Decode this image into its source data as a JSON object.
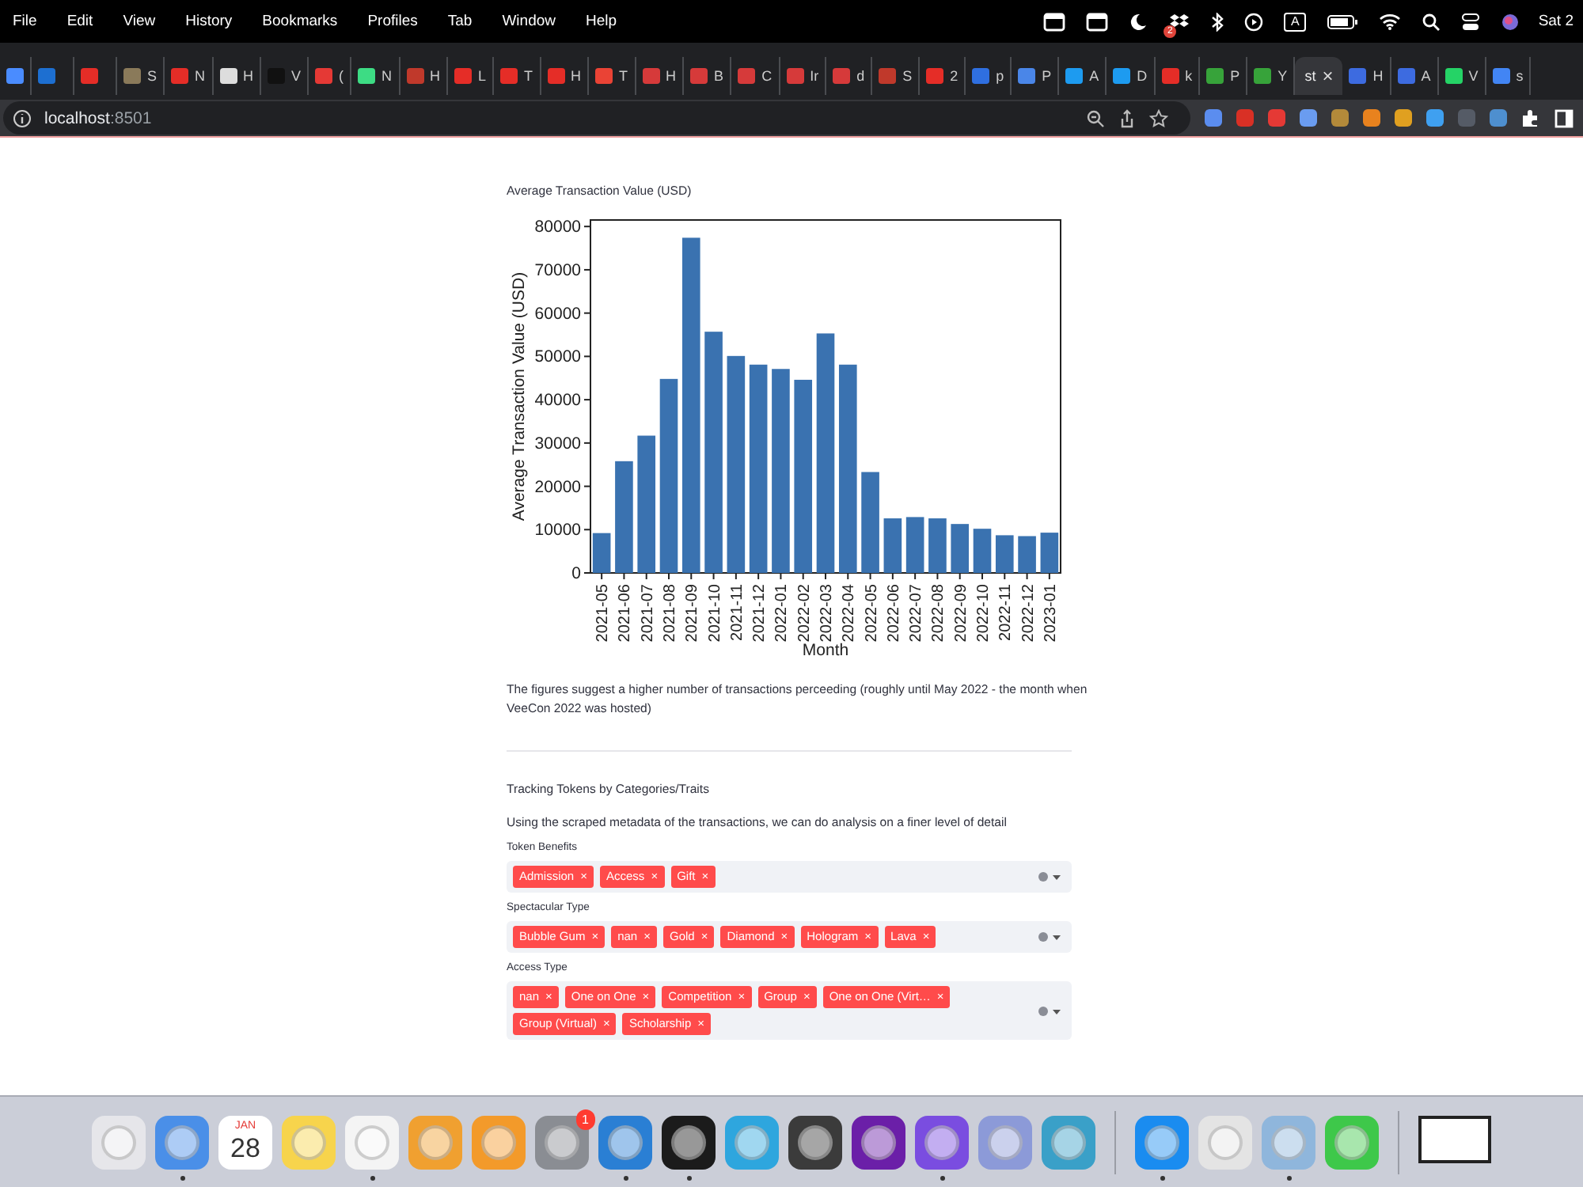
{
  "menu_bar": {
    "items": [
      "File",
      "Edit",
      "View",
      "History",
      "Bookmarks",
      "Profiles",
      "Tab",
      "Window",
      "Help"
    ],
    "status": [
      {
        "kind": "window"
      },
      {
        "kind": "window"
      },
      {
        "kind": "moon"
      },
      {
        "kind": "dropbox",
        "badge": "2"
      },
      {
        "kind": "bluetooth"
      },
      {
        "kind": "play"
      },
      {
        "kind": "input",
        "label": "A"
      },
      {
        "kind": "battery"
      },
      {
        "kind": "wifi"
      },
      {
        "kind": "search"
      },
      {
        "kind": "control"
      },
      {
        "kind": "siri"
      }
    ],
    "clock": "Sat 2"
  },
  "tabs": [
    {
      "color": "#4a8cff",
      "selected": false
    },
    {
      "color": "#1d6fd1",
      "selected": false
    },
    {
      "color": "#e52d27",
      "selected": false
    },
    {
      "title": "S",
      "color": "#8a7a5a",
      "selected": false
    },
    {
      "title": "N",
      "color": "#e52d27",
      "selected": false
    },
    {
      "title": "H",
      "color": "#dddddd",
      "selected": false
    },
    {
      "title": "V",
      "color": "#111111",
      "selected": false
    },
    {
      "title": "(",
      "color": "#e53935",
      "selected": false
    },
    {
      "title": "N",
      "color": "#3ddc84",
      "selected": false
    },
    {
      "title": "H",
      "color": "#c0392b",
      "selected": false
    },
    {
      "title": "L",
      "color": "#e52d27",
      "selected": false
    },
    {
      "title": "T",
      "color": "#e52d27",
      "selected": false
    },
    {
      "title": "H",
      "color": "#e52d27",
      "selected": false
    },
    {
      "title": "T",
      "color": "#ea4335",
      "selected": false
    },
    {
      "title": "H",
      "color": "#d63a3a",
      "selected": false
    },
    {
      "title": "B",
      "color": "#d63a3a",
      "selected": false
    },
    {
      "title": "C",
      "color": "#d63a3a",
      "selected": false
    },
    {
      "title": "Ir",
      "color": "#d63a3a",
      "selected": false
    },
    {
      "title": "d",
      "color": "#d63a3a",
      "selected": false
    },
    {
      "title": "S",
      "color": "#c0392b",
      "selected": false
    },
    {
      "title": "2",
      "color": "#e52d27",
      "selected": false
    },
    {
      "title": "p",
      "color": "#2f6fe0",
      "selected": false
    },
    {
      "title": "P",
      "color": "#4a86e8",
      "selected": false
    },
    {
      "title": "A",
      "color": "#1d9bf0",
      "selected": false
    },
    {
      "title": "D",
      "color": "#1d9bf0",
      "selected": false
    },
    {
      "title": "k",
      "color": "#e52d27",
      "selected": false
    },
    {
      "title": "P",
      "color": "#37a33a",
      "selected": false
    },
    {
      "title": "Y",
      "color": "#37a33a",
      "selected": false
    },
    {
      "title": "st",
      "close": "×",
      "selected": true
    },
    {
      "title": "H",
      "color": "#3d6be0",
      "selected": false
    },
    {
      "title": "A",
      "color": "#3d6be0",
      "selected": false
    },
    {
      "title": "V",
      "color": "#25d366",
      "selected": false
    },
    {
      "title": "s",
      "color": "#4285f4",
      "selected": false
    }
  ],
  "address_bar": {
    "host": "localhost",
    "port": ":8501",
    "extensions": [
      {
        "color": "#5b8def"
      },
      {
        "color": "#d93025"
      },
      {
        "color": "#e53935"
      },
      {
        "color": "#6a9cf0"
      },
      {
        "color": "#b38a3a"
      },
      {
        "color": "#e8821e"
      },
      {
        "color": "#e0a020"
      },
      {
        "color": "#3fa0f0"
      },
      {
        "color": "#555b66"
      },
      {
        "color": "#4e8fcf"
      }
    ]
  },
  "page": {
    "chart_title": "Average Transaction Value (USD)",
    "chart_data": {
      "type": "bar",
      "xlabel": "Month",
      "ylabel": "Average Transaction Value (USD)",
      "categories": [
        "2021-05",
        "2021-06",
        "2021-07",
        "2021-08",
        "2021-09",
        "2021-10",
        "2021-11",
        "2021-12",
        "2022-01",
        "2022-02",
        "2022-03",
        "2022-04",
        "2022-05",
        "2022-06",
        "2022-07",
        "2022-08",
        "2022-09",
        "2022-10",
        "2022-11",
        "2022-12",
        "2023-01"
      ],
      "series": [
        {
          "color": "#3a72b0",
          "values": [
            9200,
            25800,
            31700,
            44800,
            77400,
            55700,
            50100,
            48100,
            47100,
            44600,
            55300,
            48100,
            23300,
            12600,
            12900,
            12600,
            11300,
            10200,
            8700,
            8500,
            9300
          ]
        }
      ],
      "ylim": [
        0,
        81500
      ],
      "yticks": [
        0,
        10000,
        20000,
        30000,
        40000,
        50000,
        60000,
        70000,
        80000
      ]
    },
    "note": "The figures suggest a higher number of transactions perceeding (roughly until May 2022 - the month when VeeCon 2022 was hosted)",
    "section_title": "Tracking Tokens by Categories/Traits",
    "intro": "Using the scraped metadata of the transactions, we can do analysis on a finer level of detail",
    "multiselects": [
      {
        "label": "Token Benefits",
        "tags": [
          "Admission",
          "Access",
          "Gift"
        ]
      },
      {
        "label": "Spectacular Type",
        "tags": [
          "Bubble Gum",
          "nan",
          "Gold",
          "Diamond",
          "Hologram",
          "Lava"
        ]
      },
      {
        "label": "Access Type",
        "tags": [
          "nan",
          "One on One",
          "Competition",
          "Group",
          "One on One (Virt…",
          "Group (Virtual)",
          "Scholarship"
        ]
      }
    ],
    "tag_remove": "×"
  },
  "dock": {
    "groups": [
      [
        {
          "kind": "tile",
          "color": "#e6e6ea",
          "running": false
        },
        {
          "kind": "tile",
          "color": "#4a8fe8",
          "running": true
        },
        {
          "kind": "calendar",
          "month": "JAN",
          "day": "28",
          "running": false
        },
        {
          "kind": "tile",
          "color": "#f7d44c",
          "running": false
        },
        {
          "kind": "tile",
          "color": "#f4f4f4",
          "running": true
        },
        {
          "kind": "tile",
          "color": "#f0a030",
          "running": false
        },
        {
          "kind": "tile",
          "color": "#f39a2a",
          "running": false
        },
        {
          "kind": "tile",
          "color": "#8a8d93",
          "badge": "1",
          "running": false
        },
        {
          "kind": "tile",
          "color": "#2a7fd4",
          "running": true
        },
        {
          "kind": "tile",
          "color": "#1b1b1b",
          "running": true
        },
        {
          "kind": "tile",
          "color": "#2ea6de",
          "running": false
        },
        {
          "kind": "tile",
          "color": "#3b3b3b",
          "running": false
        },
        {
          "kind": "tile",
          "color": "#6b1fa8",
          "running": false
        },
        {
          "kind": "tile",
          "color": "#7a4de0",
          "running": true
        },
        {
          "kind": "tile",
          "color": "#8c9ad8",
          "running": false
        },
        {
          "kind": "tile",
          "color": "#3aa0c8",
          "running": false
        }
      ],
      [
        {
          "kind": "tile",
          "color": "#1a8cf0",
          "running": true
        },
        {
          "kind": "tile",
          "color": "#e4e4e4",
          "running": false
        },
        {
          "kind": "tile",
          "color": "#8fb6dc",
          "running": true
        },
        {
          "kind": "tile",
          "color": "#3ec84a",
          "running": false
        }
      ],
      [
        {
          "kind": "window",
          "running": false
        }
      ]
    ]
  }
}
